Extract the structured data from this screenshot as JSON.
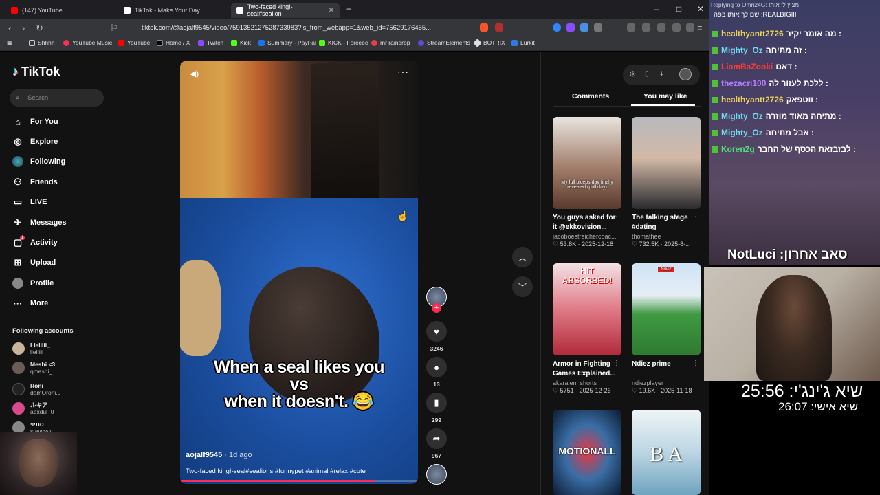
{
  "browser": {
    "tabs": [
      {
        "label": "(147) YouTube",
        "color": "#ff0000"
      },
      {
        "label": "TikTok - Make Your Day",
        "color": "#ffffff"
      },
      {
        "label": "Two-faced king!-seal#sealion",
        "color": "#ffffff"
      }
    ],
    "url": "tiktok.com/@aojalf9545/video/7591352127528733983?is_from_webapp=1&web_id=75629176455...",
    "bookmarks": [
      "Shhhh",
      "YouTube Music",
      "YouTube",
      "Home / X",
      "Twitch",
      "Kick",
      "Summary - PayPal",
      "KICK - Forceee",
      "mr raindrop",
      "StreamElements",
      "BOTRIX",
      "Lurkit"
    ]
  },
  "sidebar": {
    "logo": "TikTok",
    "search_placeholder": "Search",
    "nav": [
      {
        "label": "For You",
        "icon": "home-icon"
      },
      {
        "label": "Explore",
        "icon": "compass-icon"
      },
      {
        "label": "Following",
        "icon": "following-icon"
      },
      {
        "label": "Friends",
        "icon": "friends-icon"
      },
      {
        "label": "LIVE",
        "icon": "live-icon"
      },
      {
        "label": "Messages",
        "icon": "messages-icon"
      },
      {
        "label": "Activity",
        "icon": "activity-icon"
      },
      {
        "label": "Upload",
        "icon": "upload-icon"
      },
      {
        "label": "Profile",
        "icon": "profile-icon"
      },
      {
        "label": "More",
        "icon": "more-icon"
      }
    ],
    "activity_badge": "1",
    "following_title": "Following accounts",
    "accounts": [
      {
        "name": "Lieliiii_",
        "handle": "lieliiii_"
      },
      {
        "name": "Meshi <3",
        "handle": "qmeshi_"
      },
      {
        "name": "Roni",
        "handle": "damOroni.u"
      },
      {
        "name": "ルキア",
        "handle": "abxdul_0"
      },
      {
        "name": "סתיוי",
        "handle": "stavyyyy"
      }
    ]
  },
  "video": {
    "caption_line1": "When a seal likes you",
    "caption_line2": "vs",
    "caption_line3": "when it doesn't. 😂",
    "author": "aojalf9545",
    "age": "· 1d ago",
    "description": "Two-faced king!-seal#sealions #funnypet #animal #relax #cute",
    "progress": 0.82,
    "likes": "3246",
    "comments": "13",
    "saves": "299",
    "shares": "967"
  },
  "right_panel": {
    "tabs": [
      "Comments",
      "You may like"
    ],
    "cards": [
      {
        "title": "You guys asked for it @ekkovision...",
        "author": "jacoboestreichercoac...",
        "stats": "♡ 53.8K · 2025-12-18",
        "overlay": "My full biceps day finally revealed (pull day)"
      },
      {
        "title": "The talking stage #dating",
        "author": "thomathee",
        "stats": "♡ 732.5K · 2025-8-...",
        "overlay": ""
      },
      {
        "title": "Armor in Fighting Games Explained...",
        "author": "akaraien_shorts",
        "stats": "♡ 5751 · 2025-12-26",
        "overlay": "HIT ABSORBED!"
      },
      {
        "title": "Ndiez prime",
        "author": "ndiezplayer",
        "stats": "♡ 19.6K · 2025-11-18",
        "overlay": "Ndiez"
      },
      {
        "title": "",
        "author": "",
        "stats": "",
        "overlay": "MOTIONALL"
      },
      {
        "title": "",
        "author": "",
        "stats": "",
        "overlay": "B A"
      }
    ]
  },
  "chat": {
    "reply_header": "Replying to Omri24G: מצוץ לי אותו",
    "top_line": "שם לך אותו בפה :REALBIGIII",
    "messages": [
      {
        "user": "healthyantt2726",
        "text": "מה אומר יקיר :",
        "color": "#e8d25a"
      },
      {
        "user": "Mighty_Oz",
        "text": "זה מתיחה :",
        "color": "#6fdcf0"
      },
      {
        "user": "LiamBaZooki",
        "text": "דאם :",
        "color": "#ff3b2f"
      },
      {
        "user": "thezacri100",
        "text": "ללכת לעזור לה :",
        "color": "#b47cff"
      },
      {
        "user": "healthyantt2726",
        "text": "ווטפאק :",
        "color": "#e8d25a"
      },
      {
        "user": "Mighty_Oz",
        "text": "מתיחה מאוד מוזרה :",
        "color": "#6fdcf0"
      },
      {
        "user": "Mighty_Oz",
        "text": "אבל מתיחה :",
        "color": "#6fdcf0"
      },
      {
        "user": "Koren2g",
        "text": "לבזבזאת הכסף של החבר :",
        "color": "#4ee07a"
      }
    ],
    "last_sub": "NotLuci :סאב אחרון",
    "timer_main": "שיא ג'ינג'י: 25:56",
    "timer_personal": "שיא אישי: 26:07"
  }
}
